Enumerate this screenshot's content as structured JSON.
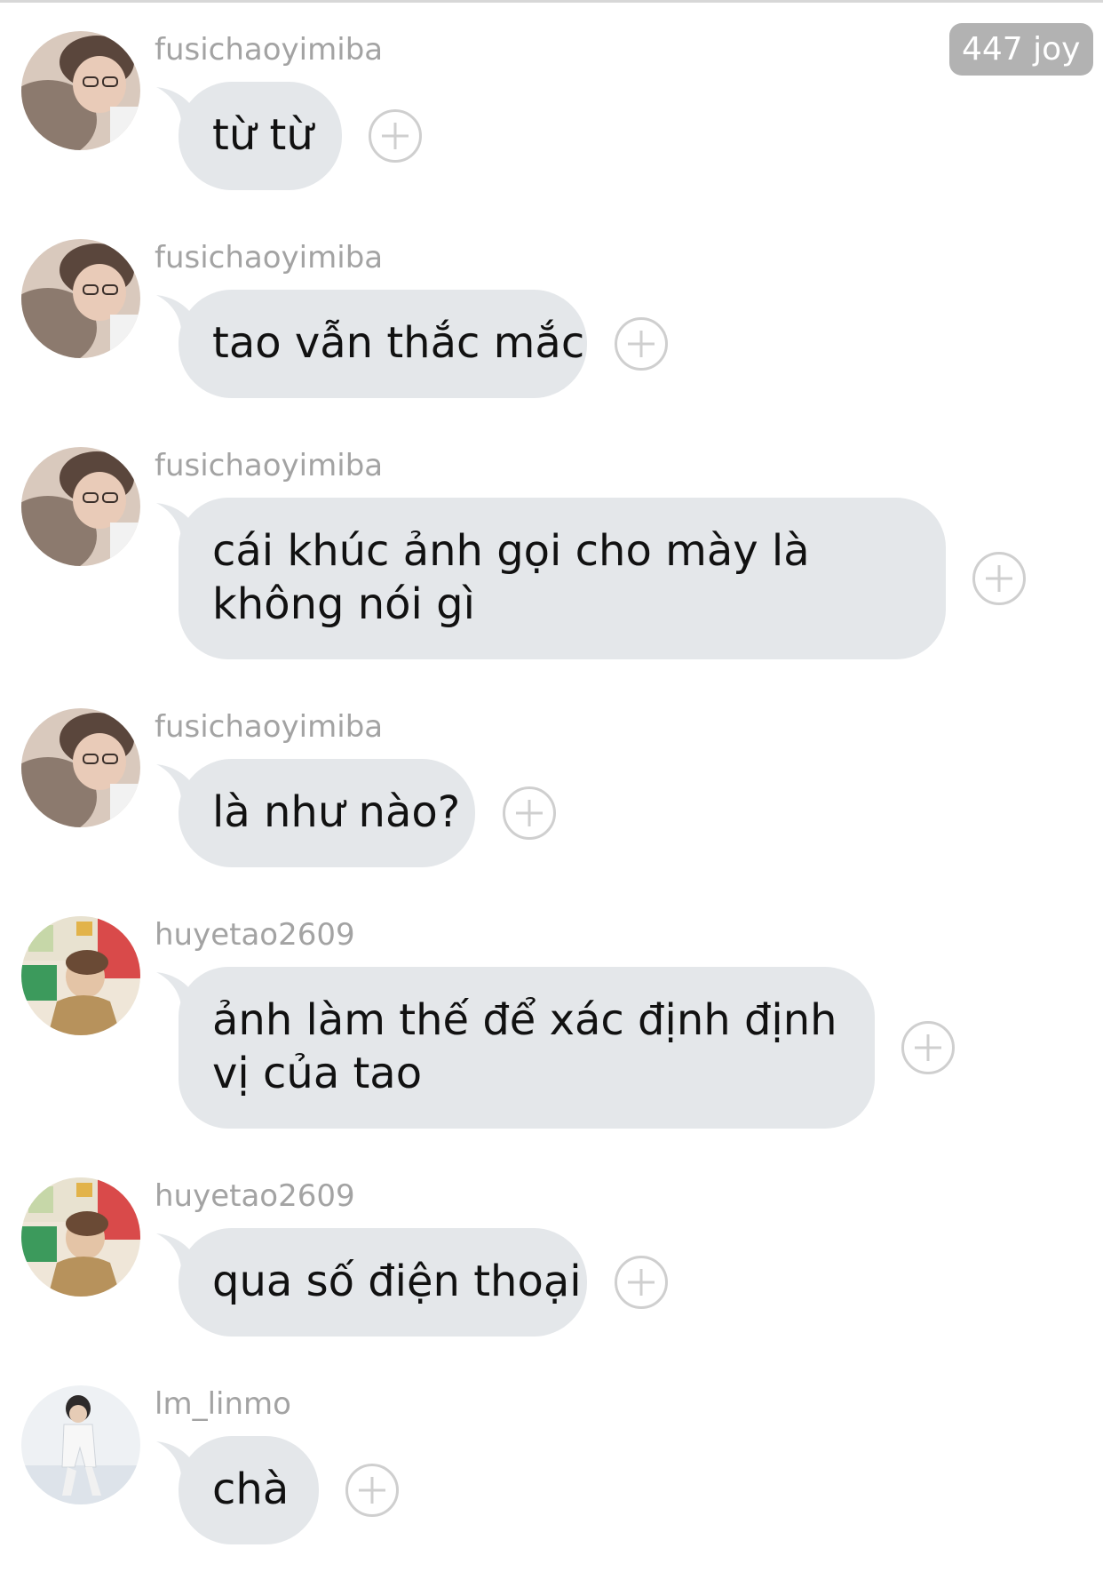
{
  "header": {
    "joy_badge": "447 joy"
  },
  "messages": [
    {
      "username": "fusichaoyimiba",
      "text": "từ từ",
      "avatar": "avatar-fusichaoyimiba"
    },
    {
      "username": "fusichaoyimiba",
      "text": "tao vẫn thắc mắc",
      "avatar": "avatar-fusichaoyimiba"
    },
    {
      "username": "fusichaoyimiba",
      "text": "cái khúc ảnh gọi cho mày là không nói gì",
      "avatar": "avatar-fusichaoyimiba"
    },
    {
      "username": "fusichaoyimiba",
      "text": "là như nào?",
      "avatar": "avatar-fusichaoyimiba"
    },
    {
      "username": "huyetao2609",
      "text": "ảnh làm thế để xác định định vị của tao",
      "avatar": "avatar-huyetao2609"
    },
    {
      "username": "huyetao2609",
      "text": "qua số điện thoại",
      "avatar": "avatar-huyetao2609"
    },
    {
      "username": "lm_linmo",
      "text": "chà",
      "avatar": "avatar-lm-linmo"
    }
  ],
  "colors": {
    "bubble": "#e4e7ea",
    "username": "#a3a3a3",
    "badge": "#b2b2b2",
    "add_button": "#cfcfcf"
  },
  "icons": {
    "add_reaction": "plus-circle-icon"
  }
}
